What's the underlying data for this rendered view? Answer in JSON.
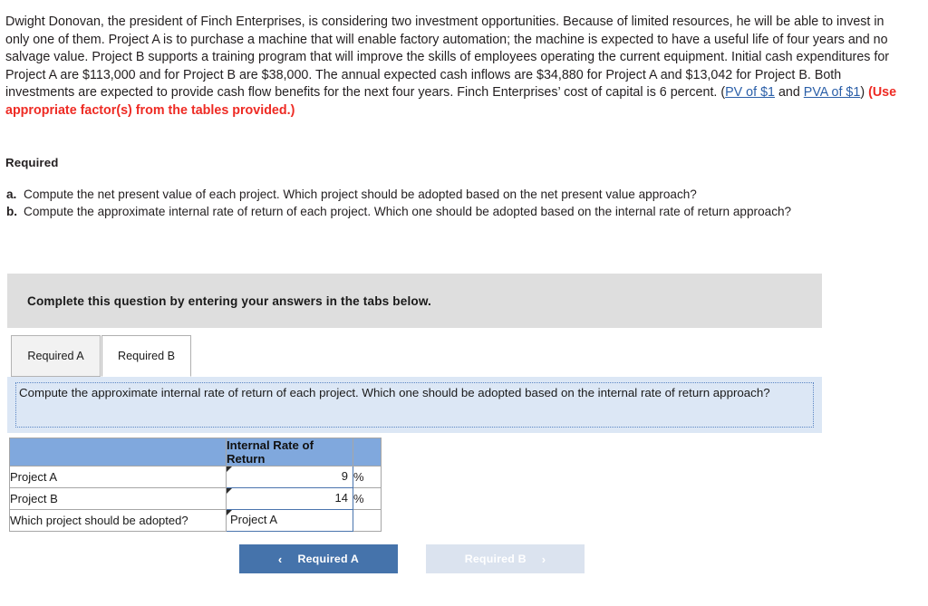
{
  "problem": {
    "part1": "Dwight Donovan, the president of Finch Enterprises, is considering two investment opportunities. Because of limited resources, he will be able to invest in only one of them. Project A is to purchase a machine that will enable factory automation; the machine is expected to have a useful life of four years and no salvage value. Project B supports a training program that will improve the skills of employees operating the current equipment. Initial cash expenditures for Project A are $113,000 and for Project B are $38,000. The annual expected cash inflows are $34,880 for Project A and $13,042 for Project B. Both investments are expected to provide cash flow benefits for the next four years. Finch Enterprises’ cost of capital is 6 percent. (",
    "link1": "PV of $1",
    "between_links": " and ",
    "link2": "PVA of $1",
    "after_links": ") ",
    "red_note": "(Use appropriate factor(s) from the tables provided.)"
  },
  "required": {
    "heading": "Required",
    "items": [
      {
        "marker": "a.",
        "text": "Compute the net present value of each project. Which project should be adopted based on the net present value approach?"
      },
      {
        "marker": "b.",
        "text": "Compute the approximate internal rate of return of each project. Which one should be adopted based on the internal rate of return approach?"
      }
    ]
  },
  "banner": {
    "text": "Complete this question by entering your answers in the tabs below."
  },
  "tabs": [
    {
      "label": "Required A",
      "active": false
    },
    {
      "label": "Required B",
      "active": true
    }
  ],
  "question_panel": {
    "text": "Compute the approximate internal rate of return of each project. Which one should be adopted based on the internal rate of return approach?"
  },
  "answer_table": {
    "headers": [
      "",
      "Internal Rate of Return",
      ""
    ],
    "rows": [
      {
        "label": "Project A",
        "value": "9",
        "unit": "%"
      },
      {
        "label": "Project B",
        "value": "14",
        "unit": "%"
      },
      {
        "label": "Which project should be adopted?",
        "value": "Project A",
        "unit": ""
      }
    ]
  },
  "nav": {
    "prev_label": "Required A",
    "prev_chevron": "‹",
    "next_label": "Required B",
    "next_chevron": "›"
  },
  "colors": {
    "accent_blue": "#4573ab",
    "table_header_blue": "#80a8dd",
    "panel_blue": "#dce7f5",
    "banner_gray": "#dedede",
    "link_blue": "#2b5fa8",
    "red": "#ee2b24"
  }
}
